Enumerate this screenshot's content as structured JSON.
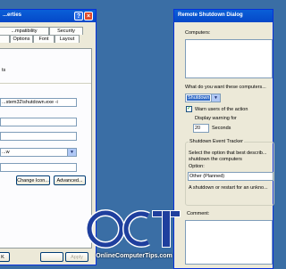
{
  "left_dialog": {
    "title": "...erties",
    "tabs_row1": [
      "...mpatibility",
      "Security"
    ],
    "tabs_row2": [
      "Options",
      "Font",
      "Layout"
    ],
    "label_fragment_1": "ts",
    "command_value": "...stem32\\shutdown.exe -i",
    "run_value": "...w",
    "change_icon_label": "Change Icon...",
    "advanced_label": "Advanced...",
    "ok_label": "K",
    "apply_label": "Apply"
  },
  "right_dialog": {
    "title": "Remote Shutdown Dialog",
    "computers_label": "Computers:",
    "action_prompt": "What do you want these computers...",
    "action_value": "Shutdown",
    "warn_label": "Warn users of the action",
    "warn_checked": true,
    "display_warning_label": "Display warning for",
    "warning_seconds": "20",
    "seconds_label": "Seconds",
    "tracker_title": "Shutdown Event Tracker",
    "tracker_desc_1": "Select the option that best describ...",
    "tracker_desc_2": "shutdown the computers",
    "option_label": "Option:",
    "option_value": "Other (Planned)",
    "option_desc": "A shutdown or restart for an unkno...",
    "comment_label": "Comment:"
  },
  "logo": {
    "text": "OnlineComputerTips.com",
    "colors": {
      "blue": "#1f3f9e",
      "white": "#ffffff"
    }
  },
  "colors": {
    "desktop": "#3a6ea5",
    "titlebar": "#0a5fd8",
    "dialog_bg": "#ece9d8",
    "selection": "#316ac5"
  }
}
